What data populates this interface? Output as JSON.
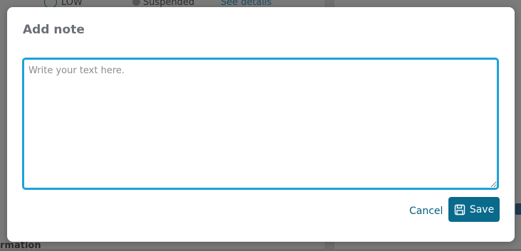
{
  "background": {
    "priority_label": "LOW",
    "status_label": "Suspended",
    "details_link": "See details",
    "section_heading": "rmation"
  },
  "modal": {
    "title": "Add note",
    "note_placeholder": "Write your text here.",
    "note_value": "",
    "cancel_label": "Cancel",
    "save_label": "Save"
  },
  "colors": {
    "accent": "#0a6a8c",
    "focus_border": "#1aa3d9",
    "link": "#00607f",
    "title": "#6b6f75"
  },
  "icons": {
    "save": "save-icon",
    "resize": "resize-handle-icon"
  }
}
